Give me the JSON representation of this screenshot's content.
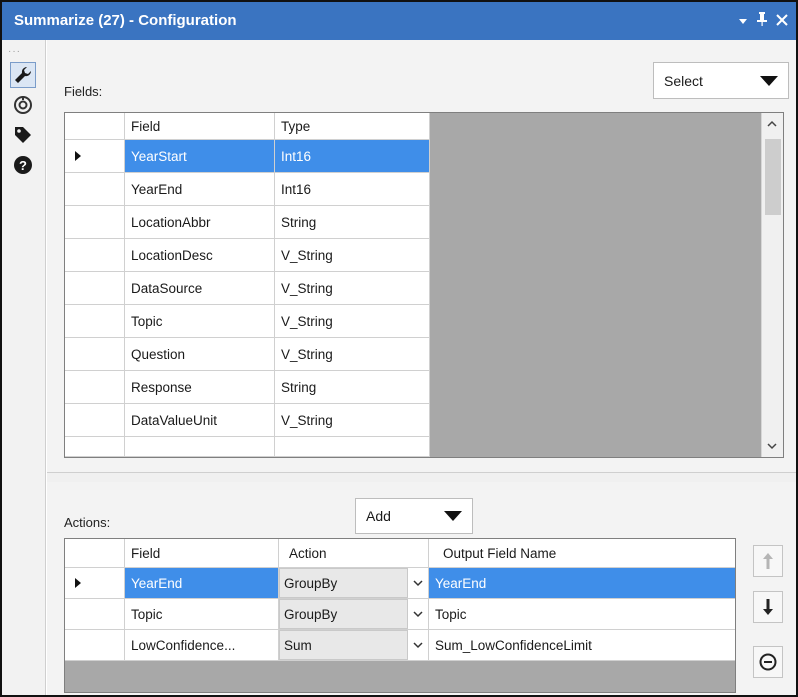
{
  "window": {
    "title": "Summarize (27) - Configuration",
    "icons": [
      "dropdown-arrow-icon",
      "pin-icon",
      "close-icon"
    ]
  },
  "toolstrip": {
    "tools": [
      "wrench-icon",
      "target-icon",
      "tag-icon",
      "help-icon"
    ]
  },
  "fields_section": {
    "label": "Fields:",
    "select_dropdown": "Select",
    "columns": [
      "Field",
      "Type"
    ],
    "rows": [
      {
        "field": "YearStart",
        "type": "Int16",
        "selected": true
      },
      {
        "field": "YearEnd",
        "type": "Int16"
      },
      {
        "field": "LocationAbbr",
        "type": "String"
      },
      {
        "field": "LocationDesc",
        "type": "V_String"
      },
      {
        "field": "DataSource",
        "type": "V_String"
      },
      {
        "field": "Topic",
        "type": "V_String"
      },
      {
        "field": "Question",
        "type": "V_String"
      },
      {
        "field": "Response",
        "type": "String"
      },
      {
        "field": "DataValueUnit",
        "type": "V_String"
      }
    ]
  },
  "actions_section": {
    "label": "Actions:",
    "add_dropdown": "Add",
    "columns": [
      "Field",
      "Action",
      "Output Field Name"
    ],
    "rows": [
      {
        "field": "YearEnd",
        "action": "GroupBy",
        "output": "YearEnd",
        "selected": true
      },
      {
        "field": "Topic",
        "action": "GroupBy",
        "output": "Topic"
      },
      {
        "field": "LowConfidence...",
        "action": "Sum",
        "output": "Sum_LowConfidenceLimit"
      }
    ],
    "side_buttons": [
      "move-up-icon",
      "move-down-icon",
      "remove-icon"
    ]
  },
  "colors": {
    "titlebar": "#3a74c1",
    "selection": "#3f8ee9",
    "grid_background": "#a8a8a8"
  }
}
